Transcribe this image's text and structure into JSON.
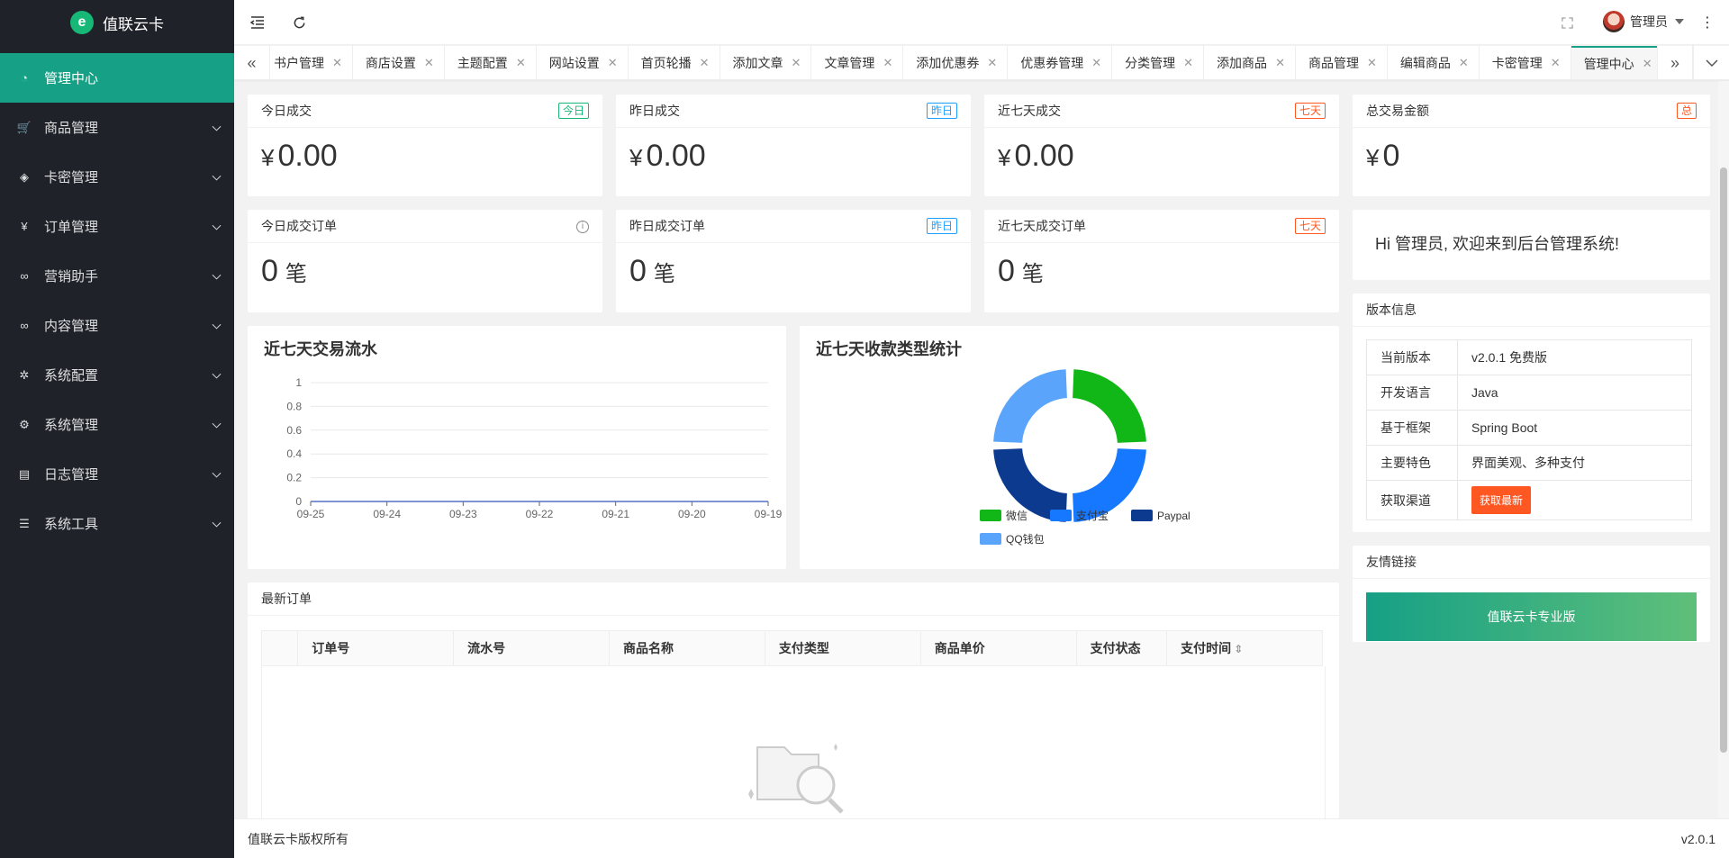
{
  "app": {
    "name": "值联云卡",
    "logo_letter": "e"
  },
  "sidebar": {
    "items": [
      {
        "label": "管理中心",
        "icon": "dashboard-icon",
        "active": true
      },
      {
        "label": "商品管理",
        "icon": "cart-icon"
      },
      {
        "label": "卡密管理",
        "icon": "layers-icon"
      },
      {
        "label": "订单管理",
        "icon": "yen-icon"
      },
      {
        "label": "营销助手",
        "icon": "link-icon"
      },
      {
        "label": "内容管理",
        "icon": "link-icon"
      },
      {
        "label": "系统配置",
        "icon": "gear-icon"
      },
      {
        "label": "系统管理",
        "icon": "cog-icon"
      },
      {
        "label": "日志管理",
        "icon": "document-icon"
      },
      {
        "label": "系统工具",
        "icon": "sliders-icon"
      }
    ]
  },
  "header": {
    "user": "管理员"
  },
  "tabs": [
    {
      "label": "书户管理"
    },
    {
      "label": "商店设置"
    },
    {
      "label": "主题配置"
    },
    {
      "label": "网站设置"
    },
    {
      "label": "首页轮播"
    },
    {
      "label": "添加文章"
    },
    {
      "label": "文章管理"
    },
    {
      "label": "添加优惠券"
    },
    {
      "label": "优惠券管理"
    },
    {
      "label": "分类管理"
    },
    {
      "label": "添加商品"
    },
    {
      "label": "商品管理"
    },
    {
      "label": "编辑商品"
    },
    {
      "label": "卡密管理"
    },
    {
      "label": "管理中心",
      "active": true
    }
  ],
  "stats": [
    {
      "title": "今日成交",
      "badge": "今日",
      "currency": "¥",
      "value": "0.00"
    },
    {
      "title": "昨日成交",
      "badge": "昨日",
      "currency": "¥",
      "value": "0.00"
    },
    {
      "title": "近七天成交",
      "badge": "七天",
      "currency": "¥",
      "value": "0.00"
    },
    {
      "title": "总交易金额",
      "badge": "总",
      "currency": "¥",
      "value": "0"
    }
  ],
  "orders_stats": [
    {
      "title": "今日成交订单",
      "value": "0",
      "unit": "笔"
    },
    {
      "title": "昨日成交订单",
      "badge": "昨日",
      "value": "0",
      "unit": "笔"
    },
    {
      "title": "近七天成交订单",
      "badge": "七天",
      "value": "0",
      "unit": "笔"
    }
  ],
  "welcome": "Hi 管理员, 欢迎来到后台管理系统!",
  "version": {
    "title": "版本信息",
    "rows": [
      {
        "k": "当前版本",
        "v": "v2.0.1 免费版"
      },
      {
        "k": "开发语言",
        "v": "Java"
      },
      {
        "k": "基于框架",
        "v": "Spring Boot"
      },
      {
        "k": "主要特色",
        "v": "界面美观、多种支付"
      },
      {
        "k": "获取渠道",
        "v": "获取最新"
      }
    ]
  },
  "links": {
    "title": "友情链接",
    "button": "值联云卡专业版"
  },
  "line_chart": {
    "title": "近七天交易流水"
  },
  "pie_chart": {
    "title": "近七天收款类型统计"
  },
  "chart_data": [
    {
      "type": "line",
      "title": "近七天交易流水",
      "x": [
        "09-25",
        "09-24",
        "09-23",
        "09-22",
        "09-21",
        "09-20",
        "09-19"
      ],
      "series": [
        {
          "values": [
            0,
            0,
            0,
            0,
            0,
            0,
            0
          ]
        }
      ],
      "yticks": [
        "0",
        "0.2",
        "0.4",
        "0.6",
        "0.8",
        "1"
      ],
      "ylim": [
        0,
        1
      ],
      "grid": true
    },
    {
      "type": "pie",
      "title": "近七天收款类型统计",
      "categories": [
        "微信",
        "支付宝",
        "Paypal",
        "QQ钱包"
      ],
      "values": [
        1,
        1,
        1,
        1
      ],
      "colors": [
        "#11b716",
        "#1677ff",
        "#0b3a8f",
        "#5ba4fb"
      ],
      "legend": "bottom"
    }
  ],
  "orders_table": {
    "title": "最新订单",
    "columns": [
      "订单号",
      "流水号",
      "商品名称",
      "支付类型",
      "商品单价",
      "支付状态",
      "支付时间"
    ]
  },
  "footer": {
    "left": "值联云卡版权所有",
    "right": "v2.0.1"
  },
  "colors": {
    "accent": "#16a085",
    "sidebar": "#20222a",
    "orange": "#ff5722"
  }
}
